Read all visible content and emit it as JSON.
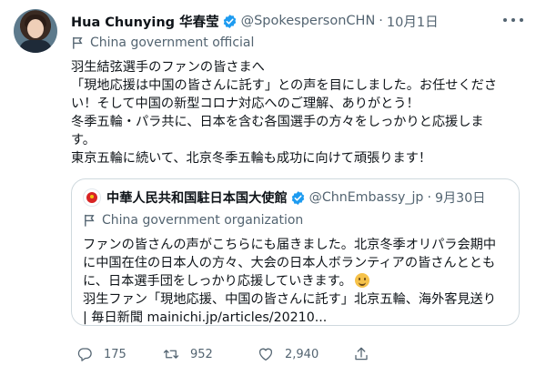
{
  "author": {
    "name": "Hua Chunying 华春莹",
    "handle": "@SpokespersonCHN",
    "separator": "·",
    "date": "10月1日",
    "label": "China government official"
  },
  "body_lines": [
    "羽生結弦選手のファンの皆さまへ",
    "「現地応援は中国の皆さんに託す」との声を目にしました。お任せくださ",
    "い！そして中国の新型コロナ対応へのご理解、ありがとう！",
    "冬季五輪・パラ共に、日本を含む各国選手の方々をしっかりと応援しま",
    "す。",
    "東京五輪に続いて、北京冬季五輪も成功に向けて頑張ります！"
  ],
  "quote": {
    "name": "中華人民共和国駐日本国大使館",
    "handle": "@ChnEmbassy_jp",
    "separator": "·",
    "date": "9月30日",
    "label": "China government organization",
    "body_lines": [
      "ファンの皆さんの声がこちらにも届きました。北京冬季オリパラ会期中",
      "に中国在住の日本人の方々、大会の日本人ボランティアの皆さんととも",
      "に、日本選手団をしっかり応援していきます。",
      "羽生ファン「現地応援、中国の皆さんに託す」北京五輪、海外客見送り",
      "| 毎日新聞 mainichi.jp/articles/20210..."
    ]
  },
  "actions": {
    "replies": "175",
    "retweets": "952",
    "likes": "2,940"
  },
  "icons": {
    "verified": "verified-badge-icon",
    "label_flag": "flag-icon",
    "more": "more-options-icon",
    "reply": "reply-icon",
    "retweet": "retweet-icon",
    "like": "heart-icon",
    "share": "share-icon",
    "emoji": "smiling-face-emoji"
  },
  "colors": {
    "verified": "#1d9bf0",
    "text": "#0f1419",
    "secondary": "#536471",
    "border": "#cfd9de"
  }
}
